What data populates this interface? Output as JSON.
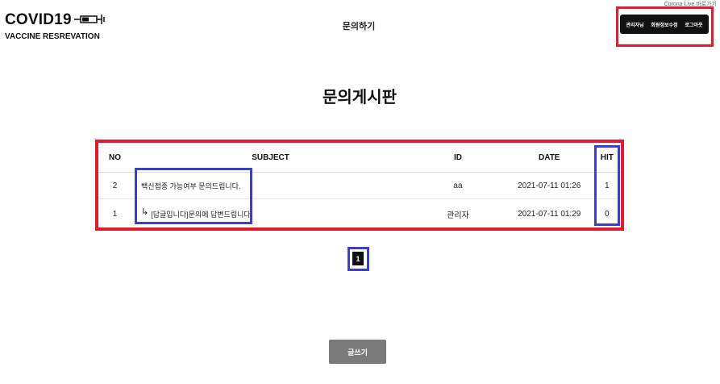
{
  "header": {
    "logo_title": "COVID19",
    "logo_subtitle": "VACCINE RESREVATION",
    "nav_title": "문의하기",
    "corona_link": "Corona Live 바로가기",
    "user_menu": [
      "관리자님",
      "회원정보수정",
      "로그아웃"
    ]
  },
  "main": {
    "board_title": "문의게시판",
    "table": {
      "headers": [
        "NO",
        "SUBJECT",
        "ID",
        "DATE",
        "HIT"
      ],
      "rows": [
        {
          "no": "2",
          "subject": "백신접종 가능여부 문의드립니다.",
          "id": "aa",
          "date": "2021-07-11 01:26",
          "hit": "1",
          "reply": false
        },
        {
          "no": "1",
          "subject": "[답글입니다]문의에 답변드립니다.",
          "id": "관리자",
          "date": "2021-07-11 01:29",
          "hit": "0",
          "reply": true
        }
      ]
    },
    "pagination": {
      "current_page": "1"
    },
    "write_button": "글쓰기"
  },
  "colors": {
    "highlight_red": "#e31b2c",
    "highlight_blue": "#3a3fd0",
    "menu_bg": "#111111",
    "write_btn_bg": "#7b7b7b"
  }
}
